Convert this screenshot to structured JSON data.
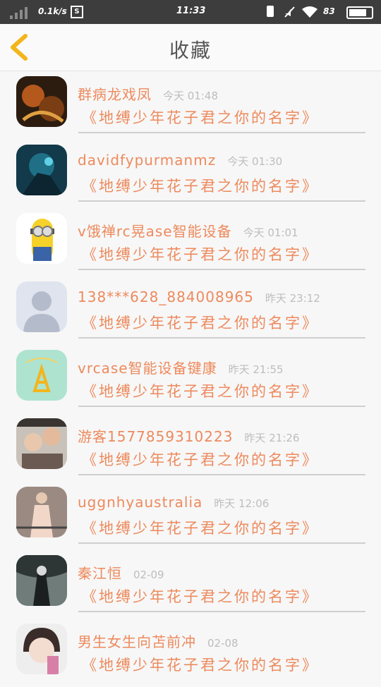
{
  "status": {
    "speed": "0.1k/s",
    "screenshot_glyph": "S",
    "time": "11:33",
    "battery_pct": "83",
    "icons": [
      "signal-icon",
      "screenshot-icon",
      "charging-icon",
      "mute-icon",
      "wifi-icon",
      "battery-icon"
    ]
  },
  "header": {
    "title": "收藏",
    "back_icon": "chevron-left-icon",
    "accent": "#f3b51c"
  },
  "colors": {
    "name": "#ed8a5d",
    "time": "#bdbdbd"
  },
  "items": [
    {
      "name": "群病龙戏凤",
      "time": "今天 01:48",
      "message": "《地缚少年花子君之你的名字》"
    },
    {
      "name": "davidfypurmanmz",
      "time": "今天 01:30",
      "message": "《地缚少年花子君之你的名字》"
    },
    {
      "name": "v饿禅rc晃ase智能设备",
      "time": "今天 01:01",
      "message": "《地缚少年花子君之你的名字》"
    },
    {
      "name": "138***628_884008965",
      "time": "昨天 23:12",
      "message": "《地缚少年花子君之你的名字》"
    },
    {
      "name": "vrcase智能设备键康",
      "time": "昨天 21:55",
      "message": "《地缚少年花子君之你的名字》"
    },
    {
      "name": "游客1577859310223",
      "time": "昨天 21:26",
      "message": "《地缚少年花子君之你的名字》"
    },
    {
      "name": "uggnhyaustralia",
      "time": "昨天 12:06",
      "message": "《地缚少年花子君之你的名字》"
    },
    {
      "name": "秦江恒",
      "time": "02-09",
      "message": "《地缚少年花子君之你的名字》"
    },
    {
      "name": "男生女生向苫前冲",
      "time": "02-08",
      "message": "《地缚少年花子君之你的名字》"
    }
  ]
}
